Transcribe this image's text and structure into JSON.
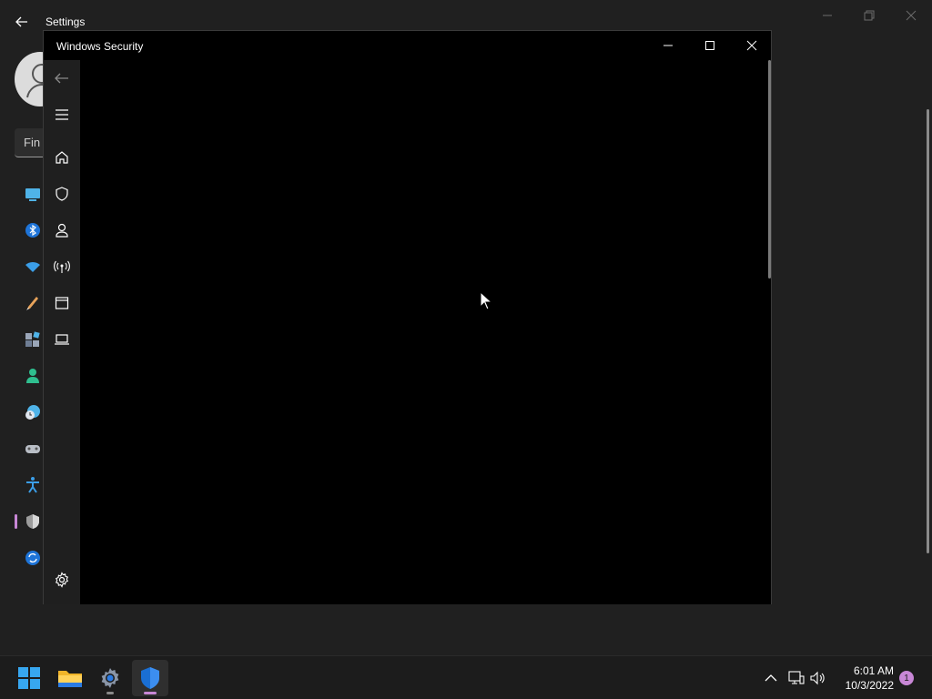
{
  "settings": {
    "title": "Settings",
    "search_text": "Fin",
    "nav_icons": [
      "system-icon",
      "bluetooth-icon",
      "network-icon",
      "personalization-icon",
      "apps-icon",
      "accounts-icon",
      "time-language-icon",
      "gaming-icon",
      "accessibility-icon",
      "privacy-security-icon",
      "windows-update-icon"
    ]
  },
  "security_window": {
    "title": "Windows Security",
    "sidebar_icons": [
      "back-arrow-icon",
      "hamburger-menu-icon",
      "home-icon",
      "shield-icon",
      "account-person-icon",
      "firewall-antenna-icon",
      "app-browser-control-icon",
      "device-security-laptop-icon",
      "settings-gear-icon"
    ]
  },
  "taskbar": {
    "apps": [
      "start-icon",
      "file-explorer-icon",
      "settings-app-icon",
      "windows-security-app-icon"
    ],
    "time": "6:01 AM",
    "date": "10/3/2022",
    "notification_count": "1"
  },
  "colors": {
    "accent": "#c887d6",
    "security_blue": "#0a74da"
  }
}
